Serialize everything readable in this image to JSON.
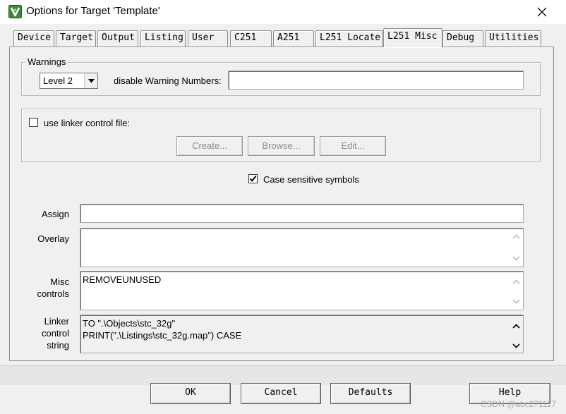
{
  "window": {
    "title": "Options for Target 'Template'"
  },
  "tabs": [
    {
      "label": "Device"
    },
    {
      "label": "Target"
    },
    {
      "label": "Output"
    },
    {
      "label": "Listing"
    },
    {
      "label": "User"
    },
    {
      "label": "C251"
    },
    {
      "label": "A251"
    },
    {
      "label": "L251 Locate"
    },
    {
      "label": "L251 Misc",
      "active": true
    },
    {
      "label": "Debug"
    },
    {
      "label": "Utilities"
    }
  ],
  "warnings": {
    "group_label": "Warnings",
    "level_value": "Level 2",
    "disable_label": "disable Warning Numbers:",
    "disable_value": ""
  },
  "linker_control_file": {
    "checkbox_label": "use linker control file:",
    "checked": false,
    "create_label": "Create...",
    "browse_label": "Browse...",
    "edit_label": "Edit..."
  },
  "case_sensitive": {
    "label": "Case sensitive symbols",
    "checked": true
  },
  "assign": {
    "label": "Assign",
    "value": ""
  },
  "overlay": {
    "label": "Overlay",
    "value": ""
  },
  "misc_controls": {
    "label_line1": "Misc",
    "label_line2": "controls",
    "value": "REMOVEUNUSED"
  },
  "linker_control_string": {
    "label_line1": "Linker",
    "label_line2": "control",
    "label_line3": "string",
    "line1": "TO \".\\Objects\\stc_32g\"",
    "line2": "PRINT(\".\\Listings\\stc_32g.map\") CASE"
  },
  "buttons": {
    "ok": "OK",
    "cancel": "Cancel",
    "defaults": "Defaults",
    "help": "Help"
  },
  "watermark": "CSDN @abc271117",
  "colors": {
    "app_icon": "#3b8a3b",
    "check_mark": "#000000",
    "disabled_text": "#8d8d8d"
  },
  "icons": [
    "app-icon",
    "close-icon",
    "chevron-down-icon",
    "check-icon",
    "scroll-up-icon",
    "scroll-down-icon"
  ]
}
